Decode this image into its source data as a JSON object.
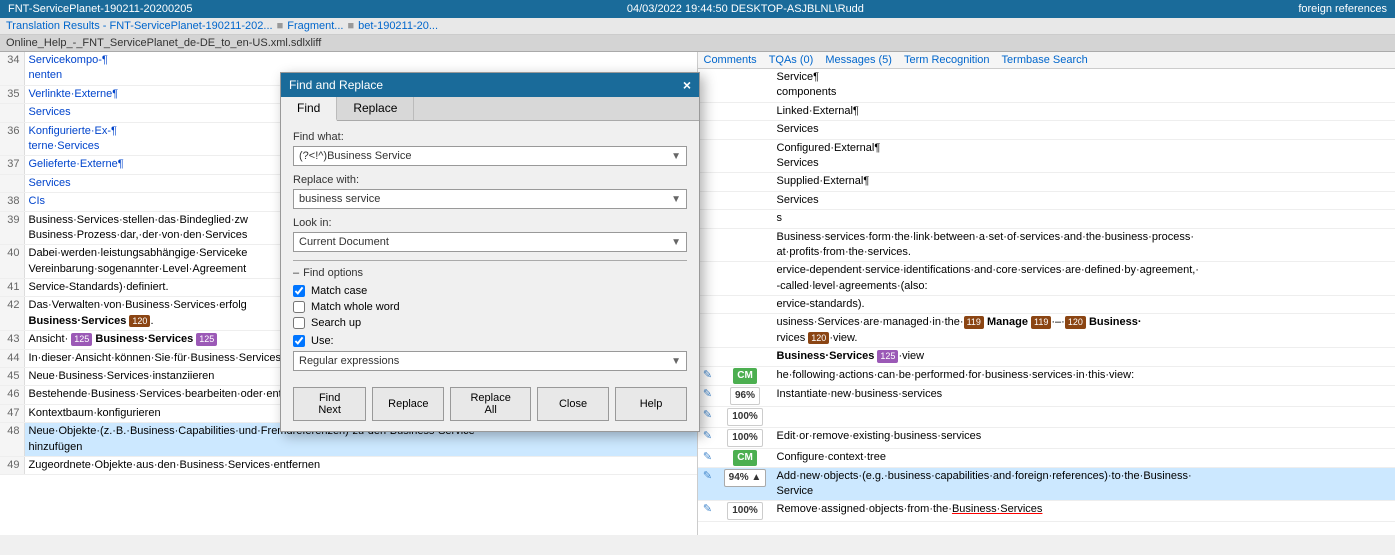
{
  "titlebar": {
    "left": "FNT-ServicePlanet-190211-20200205",
    "center": "04/03/2022 19:44:50  DESKTOP-ASJBLNL\\Rudd",
    "right_label": "foreign references"
  },
  "toolbar": {
    "item1": "Translation Results - FNT-ServicePlanet-190211-202...",
    "sep1": "■",
    "item2": "Fragment...",
    "item3": "bet-190211-20..."
  },
  "tabbar": {
    "tab": "Online_Help_-_FNT_ServicePlanet_de-DE_to_en-US.xml.sdlxliff"
  },
  "right_header": {
    "comments": "Comments",
    "tqas": "TQAs (0)",
    "messages": "Messages (5)",
    "term_recognition": "Term Recognition",
    "termbase_search": "Termbase Search"
  },
  "dialog": {
    "title": "Find and Replace",
    "close": "×",
    "tab_find": "Find",
    "tab_replace": "Replace",
    "find_what_label": "Find what:",
    "find_what_value": "(?<!^)Business Service",
    "replace_with_label": "Replace with:",
    "replace_with_value": "business service",
    "look_in_label": "Look in:",
    "look_in_value": "Current Document",
    "find_options_header": "Find options",
    "match_case_label": "Match case",
    "match_case_checked": true,
    "match_whole_word_label": "Match whole word",
    "match_whole_word_checked": false,
    "search_up_label": "Search up",
    "search_up_checked": false,
    "use_label": "Use:",
    "use_checked": true,
    "use_value": "Regular expressions",
    "btn_find_next": "Find Next",
    "btn_replace": "Replace",
    "btn_replace_all": "Replace All",
    "btn_close": "Close",
    "btn_help": "Help"
  },
  "rows": [
    {
      "num": "34",
      "source": "Servicekompo-¶ nenten",
      "target": "Service¶ components",
      "pct": "",
      "icon": ""
    },
    {
      "num": "35",
      "source": "Verlinkte·Externe¶",
      "target": "Linked·External¶",
      "pct": "",
      "icon": ""
    },
    {
      "num": "",
      "source": "Services",
      "target": "Services",
      "pct": "",
      "icon": ""
    },
    {
      "num": "36",
      "source": "Konfigurierte·Ex-¶ terne·Services",
      "target": "Configured·External¶ Services",
      "pct": "",
      "icon": ""
    },
    {
      "num": "37",
      "source": "Gelieferte·Externe¶",
      "target": "Supplied·External¶",
      "pct": "",
      "icon": ""
    },
    {
      "num": "",
      "source": "Services",
      "target": "Services",
      "pct": "",
      "icon": ""
    },
    {
      "num": "38",
      "source": "CIs",
      "target": "s",
      "pct": "",
      "icon": ""
    },
    {
      "num": "39",
      "source": "Business·Services·stellen·das·Bindeglied·zw Business·Prozess·dar,·der·von·den·Services",
      "target": "Business·services·form·the·link·between·a·set·of·services·and·the·business·process· at·profits·from·the·services.",
      "pct": "",
      "icon": ""
    },
    {
      "num": "40",
      "source": "Dabei·werden·leistungsabhängige·Serviceke Vereinbarung·sogenannter·Level·Agreement Service-Standards)·definiert.",
      "target": "ervice-dependent·service·identifications·and·core·services·are·defined·by·agreement,· -called·level·agreements·(also:· ervice-standards).",
      "pct": "",
      "icon": ""
    },
    {
      "num": "41",
      "source": "Service-Standards)·definiert.",
      "target": "ervice-standards).",
      "pct": "",
      "icon": ""
    },
    {
      "num": "42",
      "source": "Das·Verwalten·von·Business·Services·erfolg Business·Services 120 .",
      "target": "usiness·Services·are·managed·in·the·119 Manage 119 ·–· 120 Business· rvices 120 ·view.",
      "pct": "",
      "icon": ""
    },
    {
      "num": "43",
      "source": "Ansicht· 125 Business·Services 125",
      "target": "Business·Services 125 ·view",
      "pct": "",
      "icon": ""
    },
    {
      "num": "44",
      "source": "In·dieser·Ansicht·können·Sie·für·Business·Services die·folgenden·Aktionen·durchführen:",
      "target": "he·following·actions·can·be·performed·for·business·services·in·this·view:",
      "pct": "CM",
      "pct_class": "pct-cm",
      "icon": "✎"
    },
    {
      "num": "45",
      "source": "Neue·Business·Services·instanziieren",
      "target": "Instantiate·new·business·services",
      "pct": "96%",
      "pct_class": "pct-white",
      "icon": "✎"
    },
    {
      "num": "46",
      "source": "",
      "target": "",
      "pct": "100%",
      "pct_class": "pct-white",
      "icon": "✎"
    },
    {
      "num": "47",
      "source": "Bestehende·Business·Services·bearbeiten·oder·entfernen",
      "target": "Edit·or·remove·existing·business·services",
      "pct": "100%",
      "pct_class": "pct-white",
      "icon": "✎"
    },
    {
      "num": "",
      "source": "Kontextbaum·konfigurieren",
      "target": "Configure·context·tree",
      "pct": "CM",
      "pct_class": "pct-cm",
      "icon": "✎"
    },
    {
      "num": "48",
      "source": "Neue·Objekte·(z.·B.·Business·Capabilities·und·Fremdreferenzen)·zu·den·Business·Service· hinzufügen",
      "target": "Add·new·objects·(e.g.·business·capabilities·and·foreign·references)·to·the·Business· Service",
      "pct": "94%",
      "pct_class": "pct-blue-outline",
      "icon": "✎",
      "highlight": true
    },
    {
      "num": "49",
      "source": "Zugeordnete·Objekte·aus·den·Business·Services·entfernen",
      "target": "Remove·assigned·objects·from·the·Business·Services",
      "pct": "100%",
      "pct_class": "pct-white",
      "icon": "✎"
    }
  ]
}
